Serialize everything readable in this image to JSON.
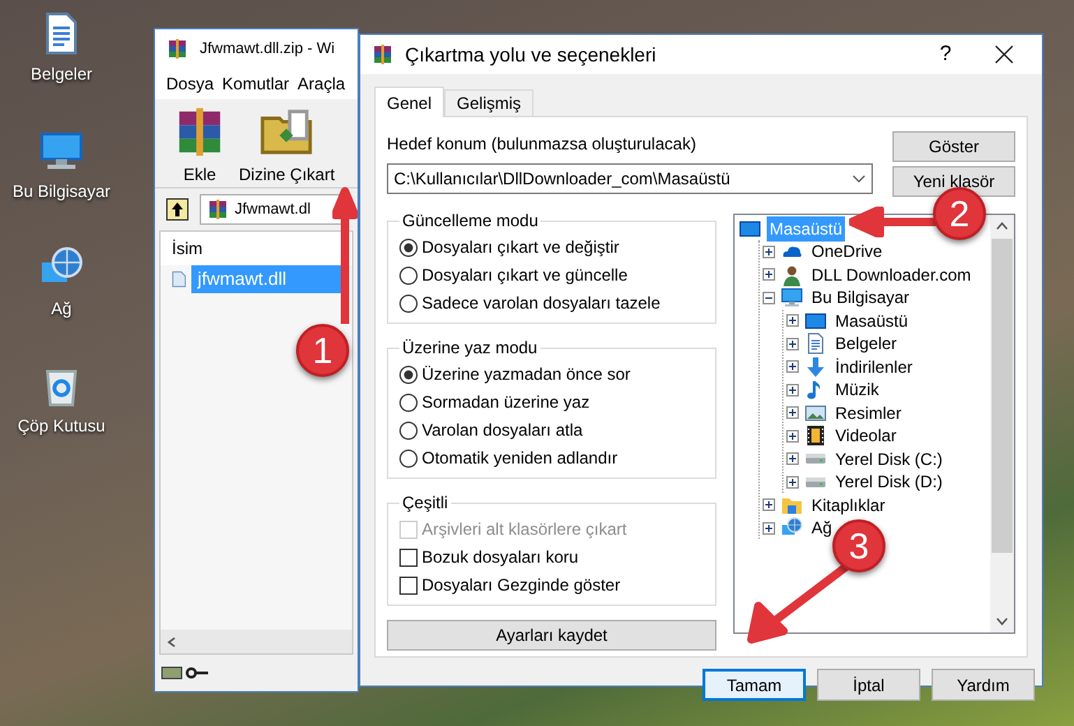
{
  "desktop_icons": [
    {
      "kind": "documents",
      "label": "Belgeler"
    },
    {
      "kind": "computer",
      "label": "Bu Bilgisayar"
    },
    {
      "kind": "network",
      "label": "Ağ"
    },
    {
      "kind": "recycle",
      "label": "Çöp Kutusu"
    }
  ],
  "archive_window": {
    "title": "Jfwmawt.dll.zip - Wi",
    "menu": [
      "Dosya",
      "Komutlar",
      "Araçla"
    ],
    "toolbar": [
      {
        "kind": "add",
        "label": "Ekle"
      },
      {
        "kind": "extract",
        "label": "Dizine Çıkart"
      }
    ],
    "path": "Jfwmawt.dl",
    "columns": [
      "İsim"
    ],
    "files": [
      {
        "name": "jfwmawt.dll",
        "selected": true
      }
    ]
  },
  "dialog": {
    "title": "Çıkartma yolu ve seçenekleri",
    "help": "?",
    "tabs": [
      {
        "label": "Genel",
        "selected": true
      },
      {
        "label": "Gelişmiş",
        "selected": false
      }
    ],
    "destination_label": "Hedef konum (bulunmazsa oluşturulacak)",
    "destination": "C:\\Kullanıcılar\\DllDownloader_com\\Masaüstü",
    "side_buttons": [
      "Göster",
      "Yeni klasör"
    ],
    "groups": [
      {
        "title": "Güncelleme modu",
        "kind": "radio",
        "options": [
          {
            "label": "Dosyaları çıkart ve değiştir",
            "selected": true
          },
          {
            "label": "Dosyaları çıkart ve güncelle",
            "selected": false
          },
          {
            "label": "Sadece varolan dosyaları tazele",
            "selected": false
          }
        ]
      },
      {
        "title": "Üzerine yaz modu",
        "kind": "radio",
        "options": [
          {
            "label": "Üzerine yazmadan önce sor",
            "selected": true
          },
          {
            "label": "Sormadan üzerine yaz",
            "selected": false
          },
          {
            "label": "Varolan dosyaları atla",
            "selected": false
          },
          {
            "label": "Otomatik yeniden adlandır",
            "selected": false
          }
        ]
      },
      {
        "title": "Çeşitli",
        "kind": "checkbox",
        "options": [
          {
            "label": "Arşivleri alt klasörlere çıkart",
            "checked": false,
            "disabled": true
          },
          {
            "label": "Bozuk dosyaları koru",
            "checked": false,
            "disabled": false
          },
          {
            "label": "Dosyaları Gezginde göster",
            "checked": false,
            "disabled": false
          }
        ]
      }
    ],
    "save_button": "Ayarları kaydet",
    "tree": [
      {
        "label": "Masaüstü",
        "kind": "desktop",
        "selected": true,
        "children": [
          {
            "label": "OneDrive",
            "kind": "cloud",
            "selected": false,
            "expanded": false
          },
          {
            "label": "DLL Downloader.com",
            "kind": "user",
            "selected": false,
            "expanded": false
          },
          {
            "label": "Bu Bilgisayar",
            "kind": "computer",
            "selected": false,
            "expanded": true,
            "children": [
              {
                "label": "Masaüstü",
                "kind": "desktop",
                "selected": false,
                "expanded": false
              },
              {
                "label": "Belgeler",
                "kind": "documents",
                "selected": false,
                "expanded": false
              },
              {
                "label": "İndirilenler",
                "kind": "download",
                "selected": false,
                "expanded": false
              },
              {
                "label": "Müzik",
                "kind": "music",
                "selected": false,
                "expanded": false
              },
              {
                "label": "Resimler",
                "kind": "pictures",
                "selected": false,
                "expanded": false
              },
              {
                "label": "Videolar",
                "kind": "videos",
                "selected": false,
                "expanded": false
              },
              {
                "label": "Yerel Disk (C:)",
                "kind": "drive",
                "selected": false,
                "expanded": false
              },
              {
                "label": "Yerel Disk (D:)",
                "kind": "drive",
                "selected": false,
                "expanded": false
              }
            ]
          },
          {
            "label": "Kitaplıklar",
            "kind": "library",
            "selected": false,
            "expanded": false
          },
          {
            "label": "Ağ",
            "kind": "network",
            "selected": false,
            "expanded": false
          }
        ]
      }
    ],
    "buttons": [
      {
        "label": "Tamam",
        "focused": true
      },
      {
        "label": "İptal",
        "focused": false
      },
      {
        "label": "Yardım",
        "focused": false
      }
    ]
  },
  "annotations": [
    {
      "label": "1"
    },
    {
      "label": "2"
    },
    {
      "label": "3"
    }
  ]
}
